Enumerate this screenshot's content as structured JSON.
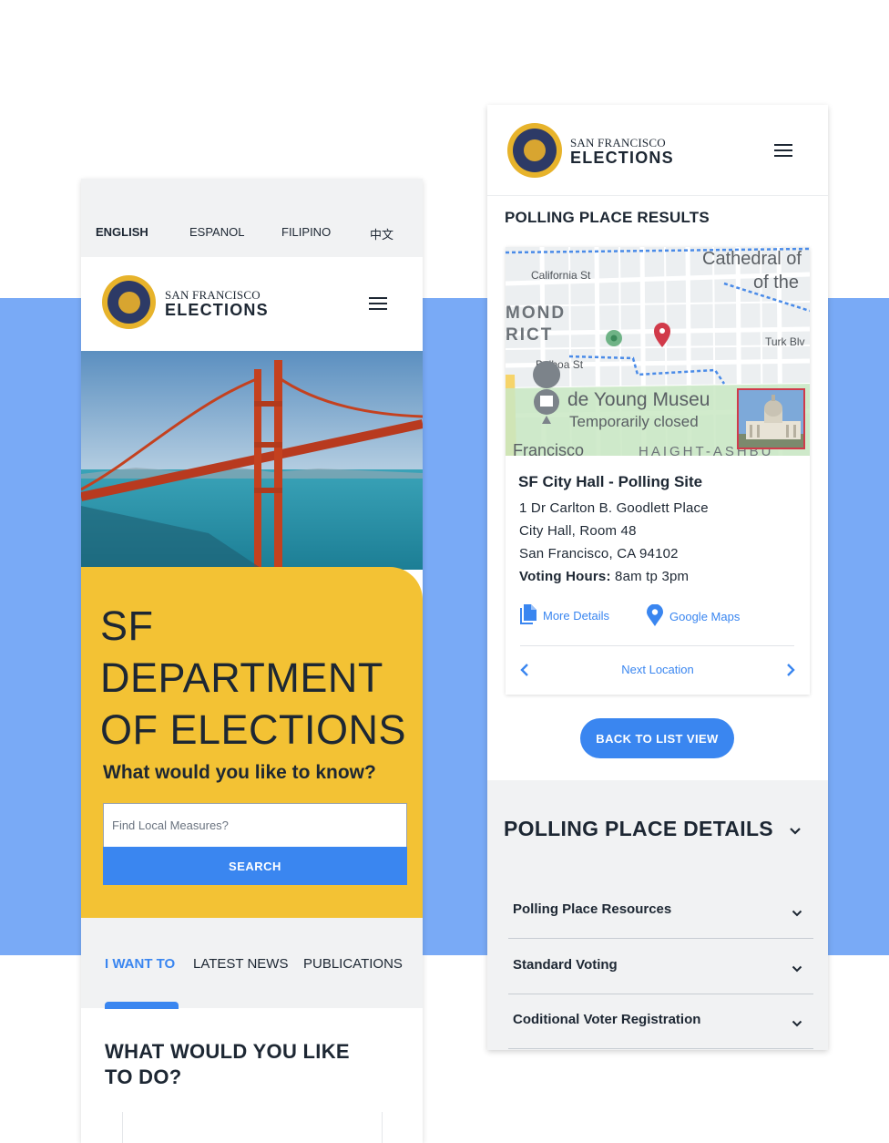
{
  "colors": {
    "accent": "#3a86f0",
    "band": "#79aaf6",
    "yellow": "#f3c234",
    "text": "#1d2733",
    "pin": "#d13a4a"
  },
  "brand": {
    "line1": "SAN FRANCISCO",
    "line2": "ELECTIONS"
  },
  "left": {
    "languages": [
      "ENGLISH",
      "ESPANOL",
      "FILIPINO",
      "中文"
    ],
    "active_language": "ENGLISH",
    "hero_title": [
      "SF",
      "DEPARTMENT",
      "OF ELECTIONS"
    ],
    "question": "What would you like to know?",
    "search": {
      "placeholder": "Find Local Measures?",
      "value": "",
      "button": "SEARCH"
    },
    "tabs": [
      "I WANT TO",
      "LATEST NEWS",
      "PUBLICATIONS"
    ],
    "active_tab": "I WANT TO",
    "section_title": [
      "WHAT WOULD YOU LIKE",
      "TO DO?"
    ],
    "icons": {
      "menu": "hamburger-icon",
      "seal": "city-seal-logo"
    }
  },
  "right": {
    "results_title": "POLLING PLACE RESULTS",
    "map_labels": [
      "Cathedral of",
      "of the",
      "California St",
      "MOND",
      "RICT",
      "Balboa St",
      "Turk Blv",
      "de Young Museu",
      "Temporarily closed",
      "Francisco",
      "HAIGHT-ASHBU"
    ],
    "site": {
      "name": "SF City Hall - Polling Site",
      "address": [
        "1 Dr Carlton B. Goodlett Place",
        "City Hall, Room 48",
        "San Francisco, CA 94102"
      ],
      "hours_label": "Voting Hours:",
      "hours_value": "8am tp 3pm"
    },
    "links": {
      "details": "More Details",
      "maps": "Google Maps"
    },
    "next_location": "Next Location",
    "back_button": "BACK TO LIST VIEW",
    "details_title": "POLLING PLACE DETAILS",
    "accordion": [
      "Polling Place Resources",
      "Standard Voting",
      "Coditional Voter Registration"
    ],
    "icons": {
      "menu": "hamburger-icon",
      "document": "document-icon",
      "map_pin": "map-pin-icon",
      "prev": "chevron-left-icon",
      "next": "chevron-right-icon",
      "expand": "chevron-down-icon"
    }
  }
}
